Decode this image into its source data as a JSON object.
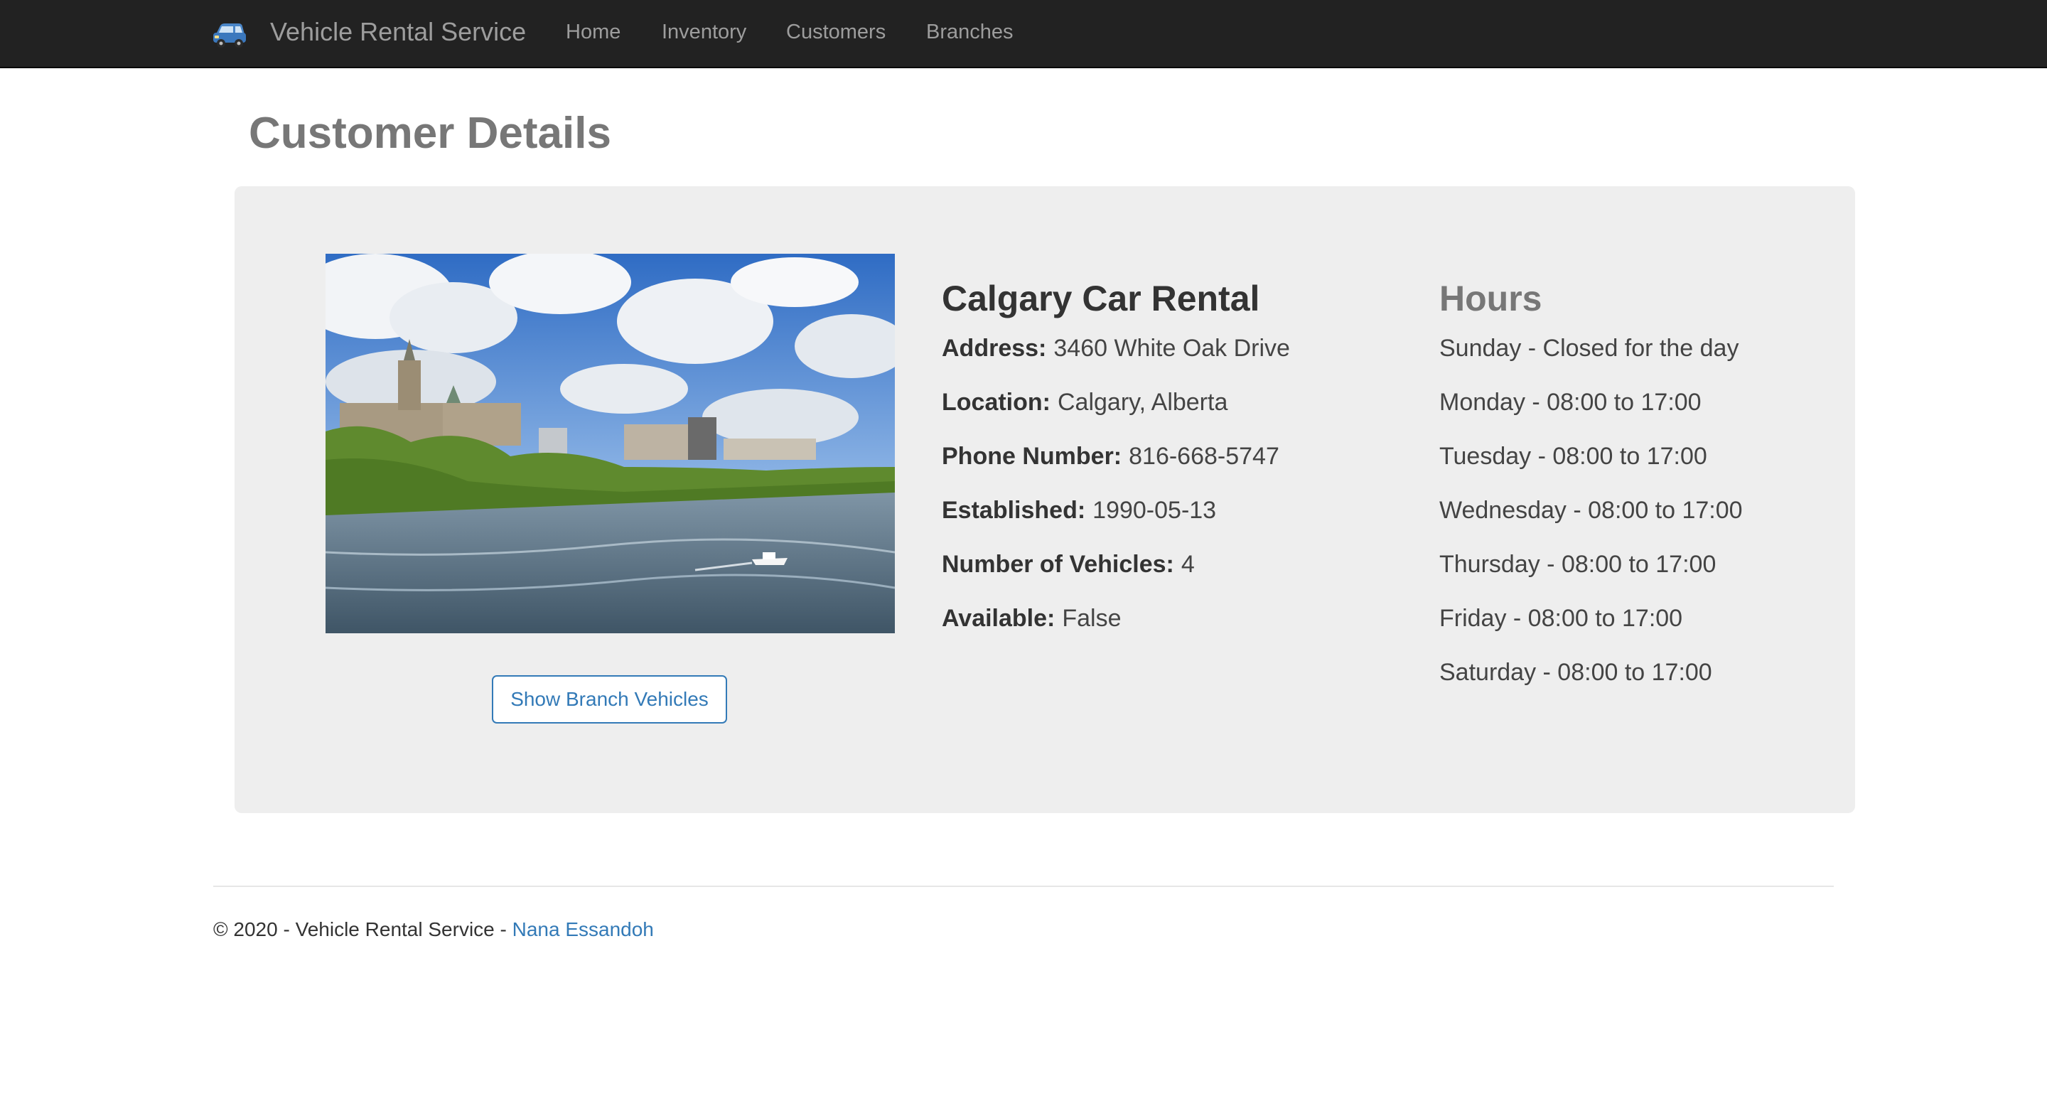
{
  "navbar": {
    "brand_icon": "car-icon",
    "brand": "Vehicle Rental Service",
    "links": [
      "Home",
      "Inventory",
      "Customers",
      "Branches"
    ]
  },
  "page": {
    "title": "Customer Details"
  },
  "branch": {
    "name": "Calgary Car Rental",
    "photo": "Parliament Hill riverside landscape photo",
    "button_label": "Show Branch Vehicles",
    "details": [
      {
        "label": "Address:",
        "value": "3460 White Oak Drive"
      },
      {
        "label": "Location:",
        "value": "Calgary, Alberta"
      },
      {
        "label": "Phone Number:",
        "value": "816-668-5747"
      },
      {
        "label": "Established:",
        "value": "1990-05-13"
      },
      {
        "label": "Number of Vehicles:",
        "value": "4"
      },
      {
        "label": "Available:",
        "value": "False"
      }
    ]
  },
  "hours": {
    "title": "Hours",
    "rows": [
      "Sunday - Closed for the day",
      "Monday - 08:00 to 17:00",
      "Tuesday - 08:00 to 17:00",
      "Wednesday - 08:00 to 17:00",
      "Thursday - 08:00 to 17:00",
      "Friday - 08:00 to 17:00",
      "Saturday - 08:00 to 17:00"
    ]
  },
  "footer": {
    "text": "© 2020 - Vehicle Rental Service - ",
    "author": "Nana Essandoh"
  },
  "colors": {
    "navbar_bg": "#222222",
    "nav_text": "#9d9d9d",
    "card_bg": "#eeeeee",
    "link_blue": "#337ab7",
    "title_gray": "#777777"
  }
}
